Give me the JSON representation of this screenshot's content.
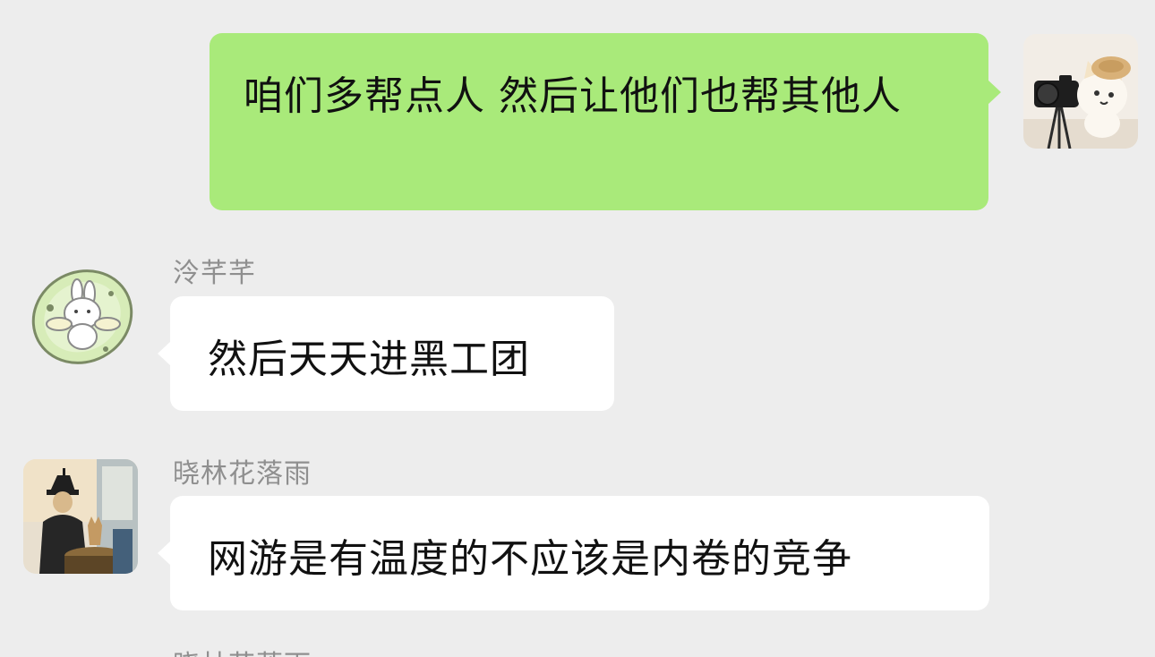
{
  "messages": [
    {
      "direction": "outgoing",
      "avatar": "cat-with-camera-avatar",
      "text": "咱们多帮点人 然后让他们也帮其他人"
    },
    {
      "direction": "incoming",
      "sender": "泠芊芊",
      "avatar": "bunny-in-leaf-avatar",
      "text": "然后天天进黑工团"
    },
    {
      "direction": "incoming",
      "sender": "晓林花落雨",
      "avatar": "painting-figure-avatar",
      "text": "网游是有温度的不应该是内卷的竞争"
    },
    {
      "direction": "incoming",
      "sender": "晓林花落雨"
    }
  ],
  "colors": {
    "background": "#ededed",
    "outgoing_bubble": "#a9ea7a",
    "incoming_bubble": "#ffffff",
    "sender_name": "#8f8f8f",
    "message_text": "#111111"
  }
}
